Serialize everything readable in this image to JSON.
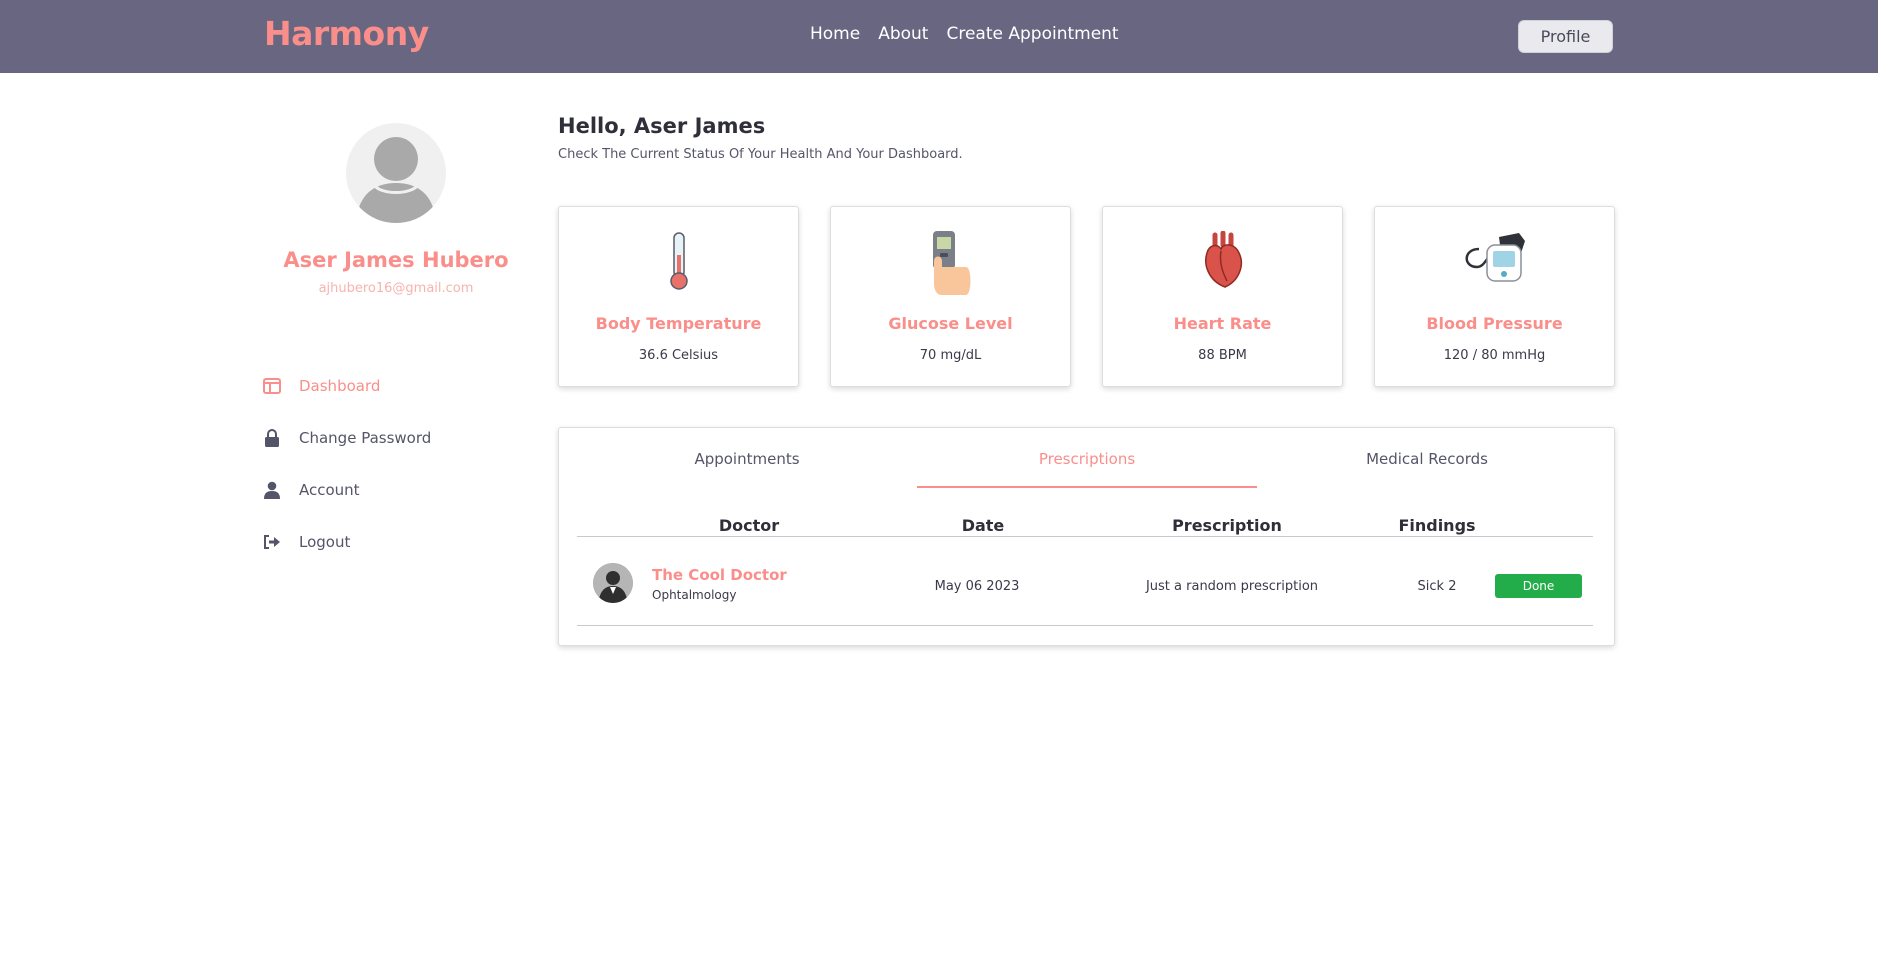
{
  "header": {
    "brand": "Harmony",
    "nav": [
      {
        "label": "Home"
      },
      {
        "label": "About"
      },
      {
        "label": "Create Appointment"
      }
    ],
    "profile_button": "Profile"
  },
  "sidebar": {
    "user_name": "Aser James Hubero",
    "user_email": "ajhubero16@gmail.com",
    "menu": [
      {
        "label": "Dashboard",
        "icon": "dashboard-icon",
        "active": true
      },
      {
        "label": "Change Password",
        "icon": "lock-icon"
      },
      {
        "label": "Account",
        "icon": "user-icon"
      },
      {
        "label": "Logout",
        "icon": "logout-icon"
      }
    ]
  },
  "main": {
    "greeting": "Hello, Aser James",
    "subtitle": "Check The Current Status Of Your Health And Your Dashboard.",
    "cards": [
      {
        "title": "Body Temperature",
        "value": "36.6 Celsius",
        "icon": "thermometer-icon"
      },
      {
        "title": "Glucose Level",
        "value": "70 mg/dL",
        "icon": "glucometer-icon"
      },
      {
        "title": "Heart Rate",
        "value": "88 BPM",
        "icon": "heart-icon"
      },
      {
        "title": "Blood Pressure",
        "value": "120 / 80 mmHg",
        "icon": "blood-pressure-monitor-icon"
      }
    ],
    "tabs": [
      {
        "label": "Appointments"
      },
      {
        "label": "Prescriptions",
        "active": true
      },
      {
        "label": "Medical Records"
      }
    ],
    "table": {
      "headers": [
        "Doctor",
        "Date",
        "Prescription",
        "Findings"
      ],
      "rows": [
        {
          "doctor": "The Cool Doctor",
          "specialty": "Ophtalmology",
          "date": "May 06 2023",
          "prescription": "Just a random prescription",
          "findings": "Sick 2",
          "status": "Done"
        }
      ]
    }
  },
  "colors": {
    "navbar": "#686681",
    "accent": "#fa8e8a",
    "status_done": "#22ad4a"
  }
}
